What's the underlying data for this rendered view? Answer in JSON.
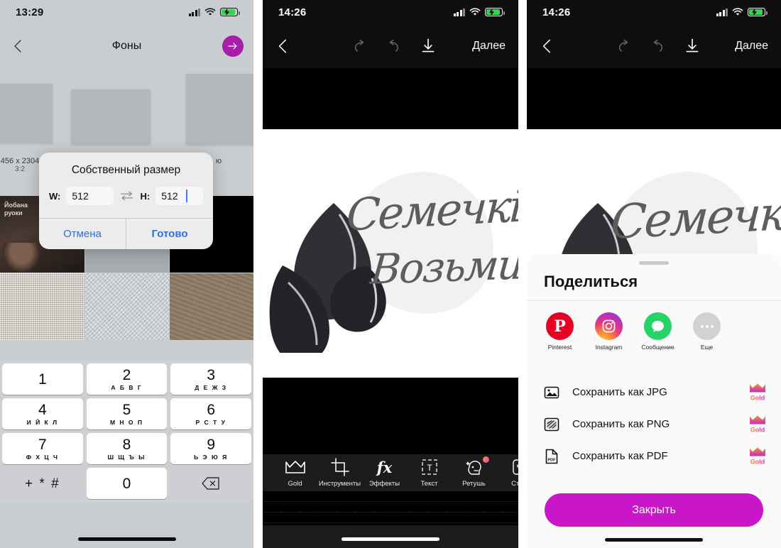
{
  "panel1": {
    "status": {
      "time": "13:29",
      "signal_icon": "signal-bars-icon",
      "wifi_icon": "wifi-icon",
      "battery_icon": "battery-charging-icon"
    },
    "nav": {
      "back_icon": "chevron-left-icon",
      "title": "Фоны",
      "next_icon": "arrow-right-icon",
      "accent": "#a81ea8"
    },
    "background_caption": {
      "size": "456 x 2304",
      "ratio": "3:2",
      "right_fragment": "ю"
    },
    "dialog": {
      "title": "Собственный размер",
      "width_label": "W:",
      "width_value": "512",
      "swap_icon": "swap-arrows-icon",
      "height_label": "H:",
      "height_value": "512",
      "cancel": "Отмена",
      "done": "Готово"
    },
    "keypad": {
      "keys": [
        {
          "num": "1",
          "sub": ""
        },
        {
          "num": "2",
          "sub": "А Б В Г"
        },
        {
          "num": "3",
          "sub": "Д Е Ж З"
        },
        {
          "num": "4",
          "sub": "И Й К Л"
        },
        {
          "num": "5",
          "sub": "М Н О П"
        },
        {
          "num": "6",
          "sub": "Р С Т У"
        },
        {
          "num": "7",
          "sub": "Ф Х Ц Ч"
        },
        {
          "num": "8",
          "sub": "Ш Щ Ъ Ы"
        },
        {
          "num": "9",
          "sub": "Ь Э Ю Я"
        }
      ],
      "symbols": "+ * #",
      "zero": "0",
      "delete_icon": "backspace-icon"
    }
  },
  "panel2": {
    "status": {
      "time": "14:26",
      "signal_icon": "signal-bars-icon",
      "wifi_icon": "wifi-icon",
      "battery_icon": "battery-charging-icon"
    },
    "nav": {
      "back_icon": "chevron-left-icon",
      "undo_icon": "undo-icon",
      "redo_icon": "redo-icon",
      "download_icon": "download-icon",
      "next_label": "Далее"
    },
    "artwork": {
      "script_line1": "Семечкі",
      "script_line2": "Возьми",
      "leaf_icon": "leaf-icon"
    },
    "toolbar": [
      {
        "label": "Gold",
        "icon": "crown-icon",
        "badge": false
      },
      {
        "label": "Инструменты",
        "icon": "crop-icon",
        "badge": false
      },
      {
        "label": "Эффекты",
        "icon": "fx-icon",
        "badge": false
      },
      {
        "label": "Текст",
        "icon": "text-box-icon",
        "badge": false
      },
      {
        "label": "Ретушь",
        "icon": "retouch-face-icon",
        "badge": true
      },
      {
        "label": "Стик",
        "icon": "sticker-icon",
        "badge": false
      }
    ]
  },
  "panel3": {
    "status": {
      "time": "14:26",
      "signal_icon": "signal-bars-icon",
      "wifi_icon": "wifi-icon",
      "battery_icon": "battery-charging-icon"
    },
    "nav": {
      "back_icon": "chevron-left-icon",
      "undo_icon": "undo-icon",
      "redo_icon": "redo-icon",
      "download_icon": "download-icon",
      "next_label": "Далее"
    },
    "artwork": {
      "script_line1": "Семечкі",
      "leaf_icon": "leaf-icon"
    },
    "sheet": {
      "title": "Поделиться",
      "apps": [
        {
          "name": "Pinterest",
          "icon": "pinterest-icon",
          "color": "#e60023"
        },
        {
          "name": "Instagram",
          "icon": "instagram-icon",
          "color": "#e8397d"
        },
        {
          "name": "Сообщение",
          "icon": "messages-icon",
          "color": "#25d366"
        },
        {
          "name": "Еще",
          "icon": "more-dots-icon",
          "color": "#d2d2d2"
        }
      ],
      "save_options": [
        {
          "label": "Сохранить как JPG",
          "icon": "image-file-icon",
          "badge": "Gold"
        },
        {
          "label": "Сохранить как PNG",
          "icon": "png-file-icon",
          "badge": "Gold"
        },
        {
          "label": "Сохранить как PDF",
          "icon": "pdf-file-icon",
          "badge": "Gold"
        }
      ],
      "close_label": "Закрыть",
      "close_color": "#c916c9"
    }
  }
}
